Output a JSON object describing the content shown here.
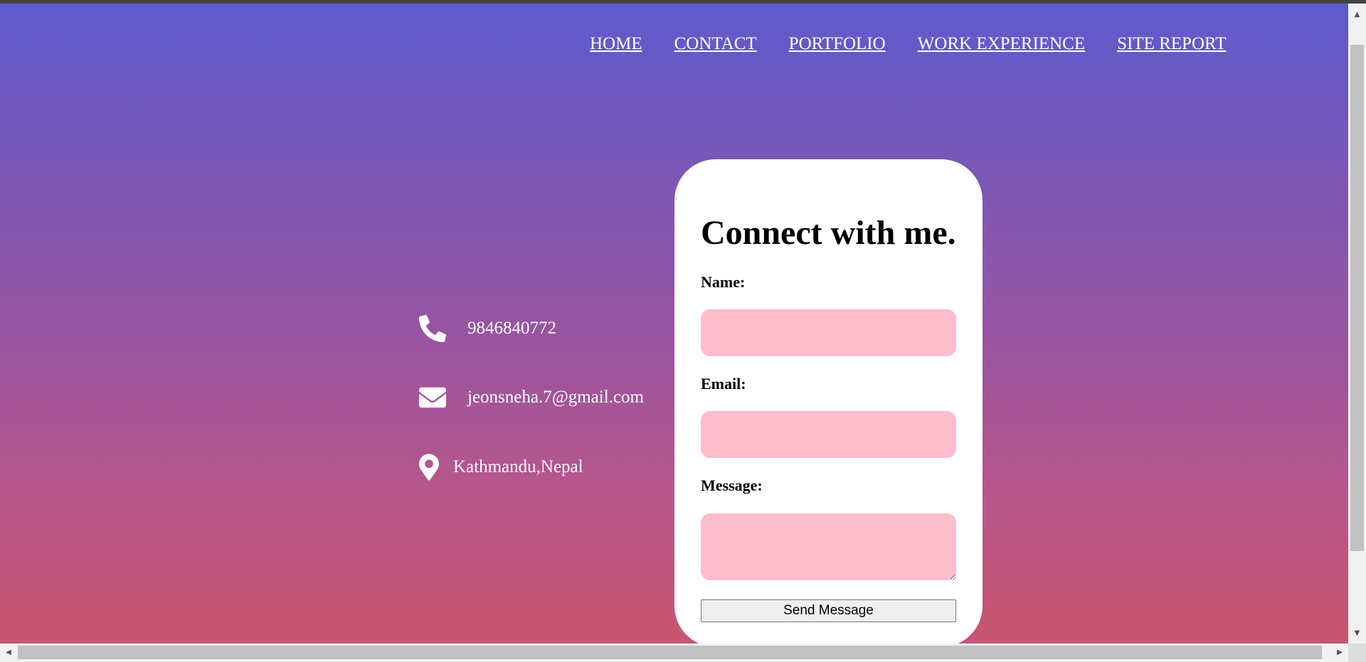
{
  "nav": {
    "items": [
      {
        "label": "HOME"
      },
      {
        "label": "CONTACT"
      },
      {
        "label": "PORTFOLIO"
      },
      {
        "label": "WORK EXPERIENCE"
      },
      {
        "label": "SITE REPORT"
      }
    ]
  },
  "contact_info": {
    "phone": {
      "icon": "phone-icon",
      "text": "9846840772"
    },
    "email": {
      "icon": "envelope-icon",
      "text": "jeonsneha.7@gmail.com"
    },
    "location": {
      "icon": "map-pin-icon",
      "text": "Kathmandu,Nepal"
    }
  },
  "form": {
    "title": "Connect with me.",
    "name_label": "Name:",
    "name_value": "",
    "email_label": "Email:",
    "email_value": "",
    "message_label": "Message:",
    "message_value": "",
    "send_label": "Send Message"
  },
  "colors": {
    "gradient_top": "#5e5acd",
    "gradient_bottom": "#c9566f",
    "field_bg": "#ffbccb",
    "card_bg": "#ffffff"
  }
}
